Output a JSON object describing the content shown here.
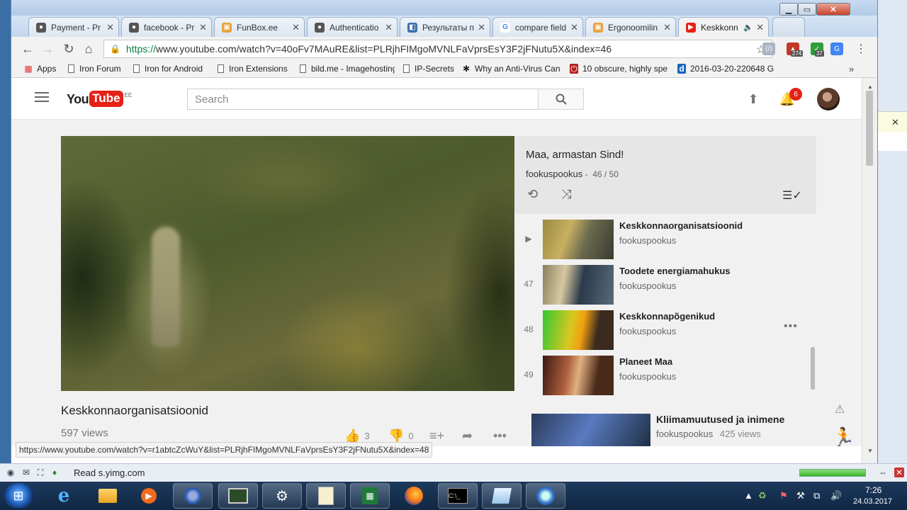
{
  "browser": {
    "tabs": [
      {
        "title": "Payment - Pr",
        "color": "#555555"
      },
      {
        "title": "facebook - Pr",
        "color": "#555555"
      },
      {
        "title": "FunBox.ee",
        "color": "#e8a23a"
      },
      {
        "title": "Authenticatio",
        "color": "#555555"
      },
      {
        "title": "Результаты п",
        "color": "#3f6fb0"
      },
      {
        "title": "compare field",
        "color": "#4285f4"
      },
      {
        "title": "Ergonoomilin",
        "color": "#e8a23a"
      },
      {
        "title": "Keskkonn",
        "color": "#e62117"
      }
    ],
    "url": "https://www.youtube.com/watch?v=40oFv7MAuRE&list=PLRjhFIMgoMVNLFaVprsEsY3F2jFNutu5X&index=46",
    "url_scheme": "https://",
    "url_rest": "www.youtube.com/watch?v=40oFv7MAuRE&list=PLRjhFIMgoMVNLFaVprsEsY3F2jFNutu5X&index=46",
    "extensions": [
      {
        "name": "code-icon",
        "badge": ""
      },
      {
        "name": "ext-red-icon",
        "badge": "274"
      },
      {
        "name": "check-icon",
        "badge": "37"
      },
      {
        "name": "translate-icon",
        "badge": ""
      }
    ],
    "bookmarks": [
      {
        "label": "Apps",
        "icon": "apps-grid-icon"
      },
      {
        "label": "Iron Forum",
        "icon": "page-icon"
      },
      {
        "label": "Iron for Android",
        "icon": "page-icon"
      },
      {
        "label": "Iron Extensions",
        "icon": "page-icon"
      },
      {
        "label": "bild.me - Imagehosting",
        "icon": "page-icon"
      },
      {
        "label": "IP-Secrets",
        "icon": "page-icon"
      },
      {
        "label": "Why an Anti-Virus Can",
        "icon": "virus-icon"
      },
      {
        "label": "10 obscure, highly spe",
        "icon": "power-icon"
      },
      {
        "label": "2016-03-20-220648 G",
        "icon": "d-icon"
      }
    ],
    "status_url": "https://www.youtube.com/watch?v=r1abtcZcWuY&list=PLRjhFIMgoMVNLFaVprsEsY3F2jFNutu5X&index=48"
  },
  "youtube": {
    "logo_you": "You",
    "logo_tube": "Tube",
    "logo_country": "EE",
    "search_placeholder": "Search",
    "notification_count": "6",
    "playlist": {
      "title": "Maa, armastan Sind!",
      "owner": "fookuspookus",
      "separator": "-",
      "position": "46 / 50",
      "items": [
        {
          "num": "▶",
          "title": "Keskkonnaorganisatsioonid",
          "owner": "fookuspookus",
          "more": ""
        },
        {
          "num": "47",
          "title": "Toodete energiamahukus",
          "owner": "fookuspookus",
          "more": ""
        },
        {
          "num": "48",
          "title": "Keskkonnapõgenikud",
          "owner": "fookuspookus",
          "more": "•••"
        },
        {
          "num": "49",
          "title": "Planeet Maa",
          "owner": "fookuspookus",
          "more": ""
        }
      ]
    },
    "video": {
      "title": "Keskkonnaorganisatsioonid",
      "views": "597 views",
      "likes": "3",
      "dislikes": "0"
    },
    "recommended": {
      "title": "Kliimamuutused ja inimene",
      "owner": "fookuspookus",
      "views": "425 views"
    }
  },
  "statusbar": {
    "text": "Read s.yimg.com"
  },
  "taskbar": {
    "time": "7:26",
    "date": "24.03.2017"
  }
}
